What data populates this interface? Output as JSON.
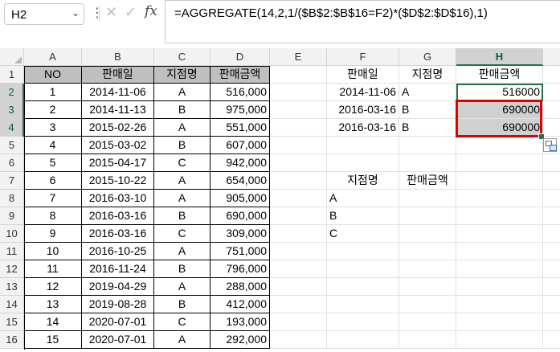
{
  "name_box": {
    "value": "H2"
  },
  "formula": {
    "text": "=AGGREGATE(14,2,1/($B$2:$B$16=F2)*($D$2:$D$16),1)"
  },
  "columns": [
    "A",
    "B",
    "C",
    "D",
    "E",
    "F",
    "G",
    "H"
  ],
  "rows": [
    "1",
    "2",
    "3",
    "4",
    "5",
    "6",
    "7",
    "8",
    "9",
    "10",
    "11",
    "12",
    "13",
    "14",
    "15",
    "16"
  ],
  "table": {
    "headers": [
      "NO",
      "판매일",
      "지점명",
      "판매금액"
    ],
    "records": [
      [
        "1",
        "2014-11-06",
        "A",
        "516,000"
      ],
      [
        "2",
        "2014-11-13",
        "B",
        "975,000"
      ],
      [
        "3",
        "2015-02-26",
        "A",
        "551,000"
      ],
      [
        "4",
        "2015-03-02",
        "B",
        "607,000"
      ],
      [
        "5",
        "2015-04-17",
        "C",
        "942,000"
      ],
      [
        "6",
        "2015-10-22",
        "A",
        "654,000"
      ],
      [
        "7",
        "2016-03-10",
        "A",
        "905,000"
      ],
      [
        "8",
        "2016-03-16",
        "B",
        "690,000"
      ],
      [
        "9",
        "2016-03-16",
        "C",
        "309,000"
      ],
      [
        "10",
        "2016-10-25",
        "A",
        "751,000"
      ],
      [
        "11",
        "2016-11-24",
        "B",
        "796,000"
      ],
      [
        "12",
        "2019-04-29",
        "A",
        "288,000"
      ],
      [
        "13",
        "2019-08-28",
        "B",
        "412,000"
      ],
      [
        "14",
        "2020-07-01",
        "C",
        "193,000"
      ],
      [
        "15",
        "2020-07-01",
        "A",
        "292,000"
      ]
    ]
  },
  "lookup": {
    "headers": [
      "판매일",
      "지점명",
      "판매금액"
    ],
    "rows": [
      [
        "2014-11-06",
        "A",
        "516000"
      ],
      [
        "2016-03-16",
        "B",
        "690000"
      ],
      [
        "2016-03-16",
        "B",
        "690000"
      ]
    ]
  },
  "summary": {
    "headers": [
      "지점명",
      "판매금액"
    ],
    "branches": [
      "A",
      "B",
      "C"
    ]
  },
  "colors": {
    "accent": "#217346",
    "highlight": "#e00000",
    "header_fill": "#bfbfbf",
    "selected_fill": "#d0d0d0"
  },
  "icons": [
    "chevron-down-icon",
    "more-icon",
    "cancel-icon",
    "check-icon",
    "fx-icon",
    "quick-analysis-icon"
  ]
}
